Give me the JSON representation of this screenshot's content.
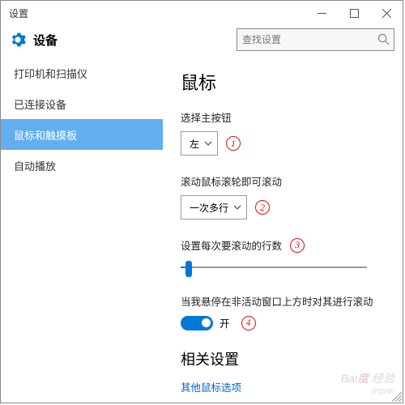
{
  "window": {
    "title": "设置"
  },
  "header": {
    "device_label": "设备"
  },
  "search": {
    "placeholder": "查找设置"
  },
  "sidebar": {
    "items": [
      {
        "label": "打印机和扫描仪"
      },
      {
        "label": "已连接设备"
      },
      {
        "label": "鼠标和触摸板"
      },
      {
        "label": "自动播放"
      }
    ],
    "selected_index": 2
  },
  "main": {
    "heading": "鼠标",
    "primary_button": {
      "label": "选择主按钮",
      "value": "左"
    },
    "scroll_mode": {
      "label": "滚动鼠标滚轮即可滚动",
      "value": "一次多行"
    },
    "lines_per_scroll": {
      "label": "设置每次要滚动的行数"
    },
    "inactive_scroll": {
      "label": "当我悬停在非活动窗口上方时对其进行滚动",
      "state": "开"
    },
    "related": {
      "heading": "相关设置",
      "link": "其他鼠标选项"
    }
  },
  "annotations": {
    "b1": "1",
    "b2": "2",
    "b3": "3",
    "b4": "4"
  },
  "watermark": {
    "main": "Bai",
    "accent": "度",
    "sub": "jingyan"
  }
}
